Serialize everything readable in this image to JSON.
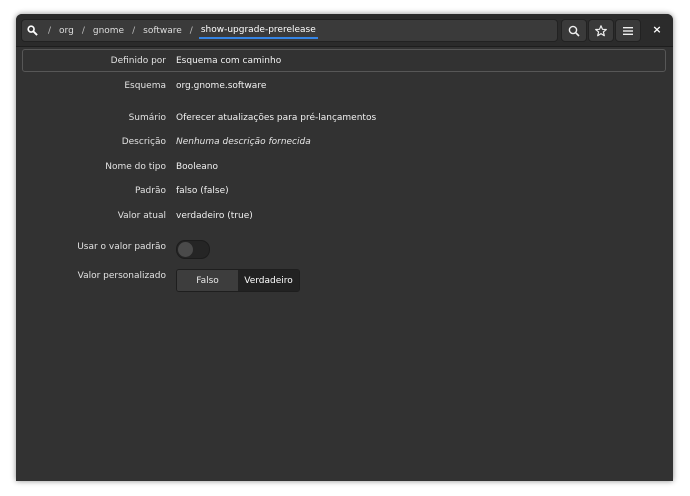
{
  "window": {
    "background": "#323232",
    "accent": "#3584e4"
  },
  "pathbar": {
    "home_icon": "search-home-icon",
    "separator": "/",
    "crumbs": [
      "org",
      "gnome",
      "software"
    ],
    "current": "show-upgrade-prerelease"
  },
  "headerbar": {
    "search_icon": "search-icon",
    "bookmark_icon": "star-icon",
    "menu_icon": "hamburger-menu-icon",
    "close_label": "×"
  },
  "details": {
    "defined_by": {
      "label": "Definido por",
      "value": "Esquema com caminho"
    },
    "schema": {
      "label": "Esquema",
      "value": "org.gnome.software"
    },
    "summary": {
      "label": "Sumário",
      "value": "Oferecer atualizações para pré-lançamentos"
    },
    "description": {
      "label": "Descrição",
      "value": "Nenhuma descrição fornecida"
    },
    "type_name": {
      "label": "Nome do tipo",
      "value": "Booleano"
    },
    "default": {
      "label": "Padrão",
      "value": "falso (false)"
    },
    "current_value": {
      "label": "Valor atual",
      "value": "verdadeiro (true)"
    },
    "use_default": {
      "label": "Usar o valor padrão",
      "state": "off"
    },
    "custom_value": {
      "label": "Valor personalizado",
      "options": [
        "Falso",
        "Verdadeiro"
      ],
      "selected": "Verdadeiro"
    }
  }
}
